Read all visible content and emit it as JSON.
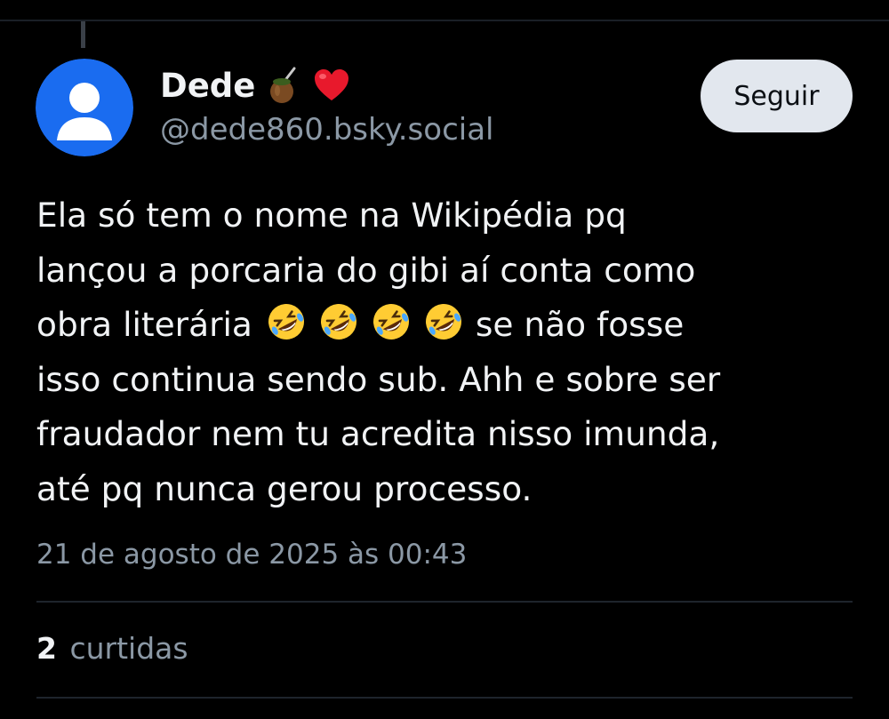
{
  "author": {
    "display_name": "Dede",
    "name_emojis": [
      "mate-gourd-emoji",
      "red-heart-emoji"
    ],
    "handle": "@dede860.bsky.social",
    "avatar_icon": "default-user-avatar-icon"
  },
  "actions": {
    "follow_label": "Seguir"
  },
  "post": {
    "lines": [
      "Ela só tem o nome na Wikipédia pq",
      "lançou a porcaria do gibi aí conta como",
      "obra literária",
      "se não fosse",
      "isso continua sendo sub. Ahh e sobre ser",
      "fraudador nem tu acredita nisso imunda,",
      "até pq nunca gerou processo."
    ],
    "inline_emojis": [
      "rolling-on-floor-laughing-emoji",
      "rolling-on-floor-laughing-emoji",
      "rolling-on-floor-laughing-emoji",
      "rolling-on-floor-laughing-emoji"
    ],
    "timestamp": "21 de agosto de 2025 às 00:43"
  },
  "stats": {
    "likes_count": "2",
    "likes_label": "curtidas"
  },
  "colors": {
    "background": "#000000",
    "text": "#f1f3f5",
    "muted": "#8b98a5",
    "avatar_blue": "#1a6cf0",
    "button_bg": "#e2e7ee"
  }
}
